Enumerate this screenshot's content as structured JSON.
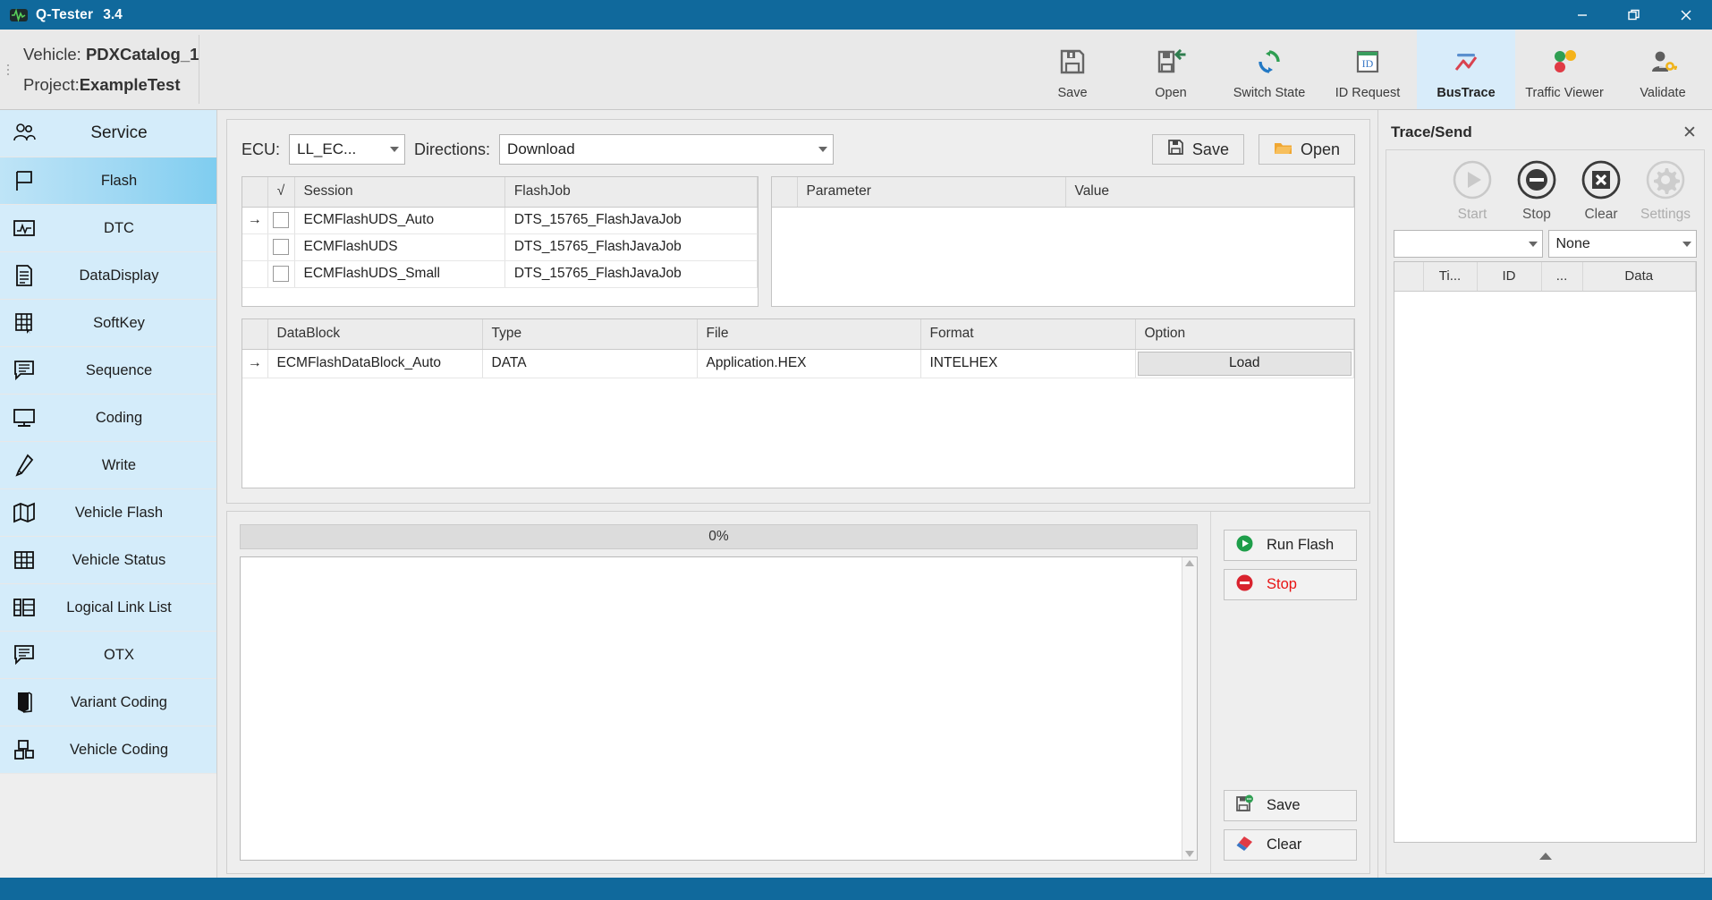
{
  "window": {
    "title": "Q-Tester",
    "version": "3.4",
    "app_icon": "waveform-icon",
    "minimize": "─",
    "restore": "restore-icon",
    "close": "✕"
  },
  "header": {
    "vehicle_label": "Vehicle:",
    "vehicle_value": "PDXCatalog_1",
    "project_label": "Project:",
    "project_value": "ExampleTest",
    "ribbon": [
      {
        "label": "Save",
        "icon": "floppy-save-icon",
        "active": false
      },
      {
        "label": "Open",
        "icon": "floppy-open-icon",
        "active": false
      },
      {
        "label": "Switch State",
        "icon": "refresh-cycle-icon",
        "active": false
      },
      {
        "label": "ID Request",
        "icon": "id-badge-icon",
        "active": false
      },
      {
        "label": "BusTrace",
        "icon": "chart-trace-icon",
        "active": true
      },
      {
        "label": "Traffic Viewer",
        "icon": "traffic-light-icon",
        "active": false
      },
      {
        "label": "Validate",
        "icon": "user-key-icon",
        "active": false
      }
    ]
  },
  "sidebar": {
    "header": {
      "label": "Service",
      "icon": "people-icon"
    },
    "items": [
      {
        "label": "Flash",
        "icon": "flag-icon",
        "selected": true
      },
      {
        "label": "DTC",
        "icon": "dtc-monitor-icon",
        "selected": false
      },
      {
        "label": "DataDisplay",
        "icon": "document-lines-icon",
        "selected": false
      },
      {
        "label": "SoftKey",
        "icon": "keypad-cursor-icon",
        "selected": false
      },
      {
        "label": "Sequence",
        "icon": "speech-lines-icon",
        "selected": false
      },
      {
        "label": "Coding",
        "icon": "monitor-icon",
        "selected": false
      },
      {
        "label": "Write",
        "icon": "pencil-icon",
        "selected": false
      },
      {
        "label": "Vehicle Flash",
        "icon": "map-icon",
        "selected": false
      },
      {
        "label": "Vehicle Status",
        "icon": "table-grid-icon",
        "selected": false
      },
      {
        "label": "Logical Link List",
        "icon": "list-columns-icon",
        "selected": false
      },
      {
        "label": "OTX",
        "icon": "speech-lines-icon",
        "selected": false
      },
      {
        "label": "Variant Coding",
        "icon": "book-icon",
        "selected": false
      },
      {
        "label": "Vehicle Coding",
        "icon": "node-network-icon",
        "selected": false
      }
    ]
  },
  "flash_panel": {
    "ecu_label": "ECU:",
    "ecu_value": "LL_EC...",
    "directions_label": "Directions:",
    "directions_value": "Download",
    "save_button": "Save",
    "open_button": "Open",
    "save_icon": "floppy-icon",
    "open_icon": "folder-icon",
    "sessions_table": {
      "columns": [
        "",
        "√",
        "Session",
        "FlashJob"
      ],
      "rows": [
        {
          "marker": "→",
          "checked": false,
          "session": "ECMFlashUDS_Auto",
          "flashjob": "DTS_15765_FlashJavaJob"
        },
        {
          "marker": "",
          "checked": false,
          "session": "ECMFlashUDS",
          "flashjob": "DTS_15765_FlashJavaJob"
        },
        {
          "marker": "",
          "checked": false,
          "session": "ECMFlashUDS_Small",
          "flashjob": "DTS_15765_FlashJavaJob"
        }
      ]
    },
    "params_table": {
      "columns": [
        "",
        "Parameter",
        "Value"
      ],
      "rows": []
    },
    "datablock_table": {
      "columns": [
        "",
        "DataBlock",
        "Type",
        "File",
        "Format",
        "Option"
      ],
      "rows": [
        {
          "marker": "→",
          "datablock": "ECMFlashDataBlock_Auto",
          "type": "DATA",
          "file": "Application.HEX",
          "format": "INTELHEX",
          "option_button": "Load"
        }
      ]
    }
  },
  "run_panel": {
    "progress_text": "0%",
    "progress_percent": 0,
    "log_text": "",
    "buttons": [
      {
        "label": "Run Flash",
        "icon": "play-circle-icon",
        "style": "normal"
      },
      {
        "label": "Stop",
        "icon": "stop-circle-icon",
        "style": "danger"
      }
    ],
    "footer_buttons": [
      {
        "label": "Save",
        "icon": "floppy-save-log-icon"
      },
      {
        "label": "Clear",
        "icon": "eraser-icon"
      }
    ]
  },
  "trace": {
    "title": "Trace/Send",
    "close_icon": "close-icon",
    "buttons": [
      {
        "label": "Start",
        "icon": "play-circle-icon",
        "disabled": true
      },
      {
        "label": "Stop",
        "icon": "stop-circle-icon",
        "disabled": false
      },
      {
        "label": "Clear",
        "icon": "clear-x-icon",
        "disabled": false
      },
      {
        "label": "Settings",
        "icon": "gear-icon",
        "disabled": true
      }
    ],
    "filter_value": "",
    "mode_value": "None",
    "table": {
      "columns": [
        "",
        "Ti...",
        "ID",
        "...",
        "Data"
      ],
      "rows": []
    },
    "collapse_icon": "chevron-up-icon"
  },
  "colors": {
    "titlebar": "#10699c",
    "accent": "#10699c",
    "sidebar_item": "#d4ecfa",
    "sidebar_selected": "#7fcdf0",
    "ribbon_active": "#d8ecfa",
    "danger": "#e81313",
    "marker_arrow": "#e8604c"
  }
}
